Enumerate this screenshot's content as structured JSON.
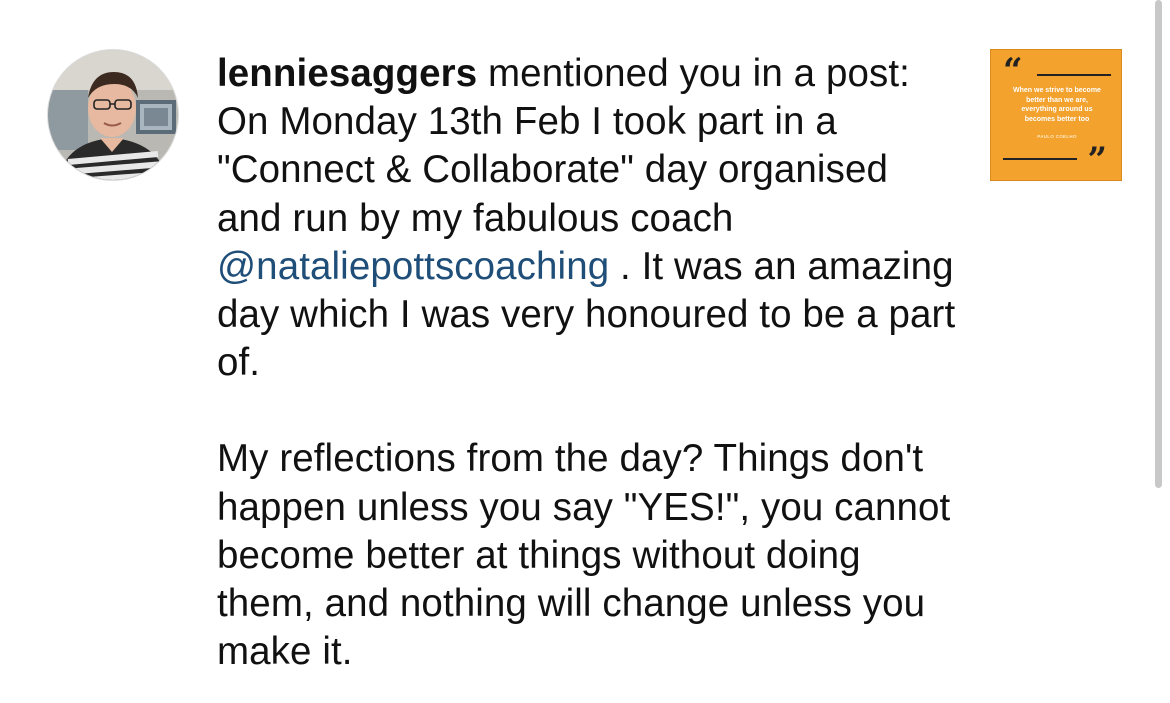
{
  "notification": {
    "username": "lenniesaggers",
    "intro": " mentioned you in a post: On Monday 13th Feb I took part in a \"Connect & Collaborate\" day organised and run by my fabulous coach ",
    "mention": "@nataliepottscoaching",
    "after_mention": " . It was an amazing day which I was very honoured to be a part of.",
    "paragraph2": "My reflections from the day? Things don't happen unless you say \"YES!\", you cannot become better at things without doing them, and nothing will change unless you make it."
  },
  "thumbnail": {
    "quote": "When we strive to become better than we are, everything around us becomes better too",
    "author": "PAULO COELHO",
    "open_quote": "“",
    "close_quote": "”",
    "background_color": "#f2a22d"
  },
  "colors": {
    "mention": "#1f4e79",
    "text": "#111111"
  },
  "icons": {
    "avatar": "user-avatar-photo",
    "scrollbar": "vertical-scrollbar"
  }
}
